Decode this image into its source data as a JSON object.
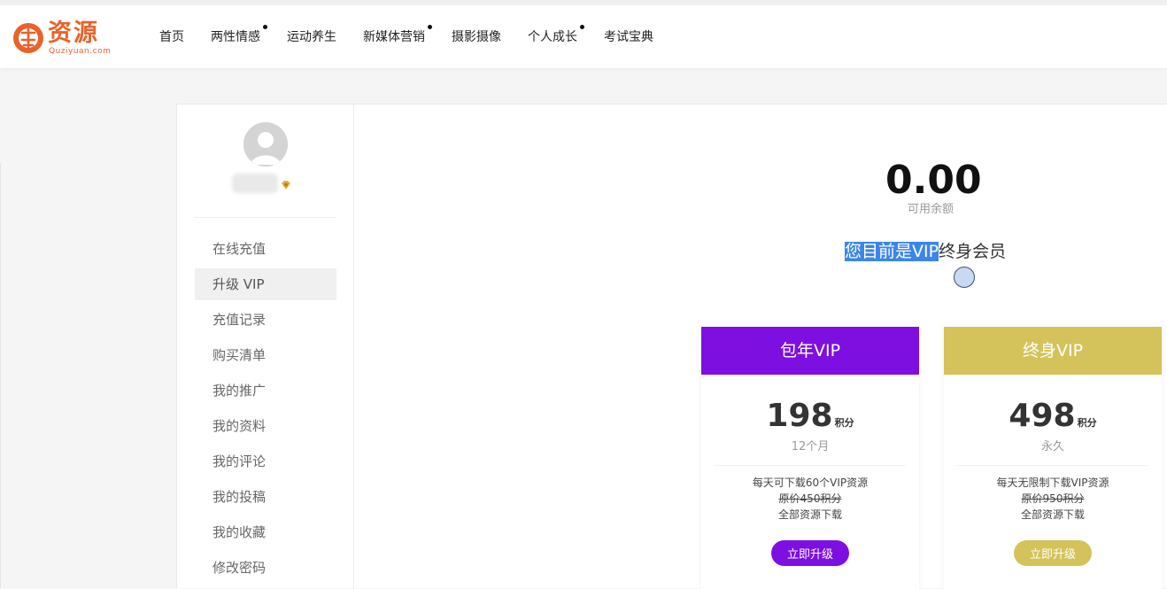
{
  "brand": {
    "name": "资源",
    "domain": "Quziyuan.com",
    "color": "#e8632b"
  },
  "nav": [
    {
      "label": "首页",
      "dot": false
    },
    {
      "label": "两性情感",
      "dot": true
    },
    {
      "label": "运动养生",
      "dot": false
    },
    {
      "label": "新媒体营销",
      "dot": true
    },
    {
      "label": "摄影摄像",
      "dot": false
    },
    {
      "label": "个人成长",
      "dot": true
    },
    {
      "label": "考试宝典",
      "dot": false
    }
  ],
  "sidebar": {
    "avatar_icon": "user-avatar",
    "vip_badge_icon": "vip-diamond",
    "items": [
      {
        "label": "在线充值",
        "active": false
      },
      {
        "label": "升级 VIP",
        "active": true
      },
      {
        "label": "充值记录",
        "active": false
      },
      {
        "label": "购买清单",
        "active": false
      },
      {
        "label": "我的推广",
        "active": false
      },
      {
        "label": "我的资料",
        "active": false
      },
      {
        "label": "我的评论",
        "active": false
      },
      {
        "label": "我的投稿",
        "active": false
      },
      {
        "label": "我的收藏",
        "active": false
      },
      {
        "label": "修改密码",
        "active": false
      }
    ]
  },
  "account": {
    "balance": "0.00",
    "balance_label": "可用余额",
    "status_highlighted": "您目前是VIP",
    "status_rest": "终身会员"
  },
  "plans": [
    {
      "title": "包年VIP",
      "price": "198",
      "unit": "积分",
      "period": "12个月",
      "features": [
        "每天可下载60个VIP资源",
        "原价450积分",
        "全部资源下载"
      ],
      "strike_index": 1,
      "button": "立即升级",
      "color": "#7d0fe0"
    },
    {
      "title": "终身VIP",
      "price": "498",
      "unit": "积分",
      "period": "永久",
      "features": [
        "每天无限制下载VIP资源",
        "原价950积分",
        "全部资源下载"
      ],
      "strike_index": 1,
      "button": "立即升级",
      "color": "#d3c35a"
    }
  ]
}
